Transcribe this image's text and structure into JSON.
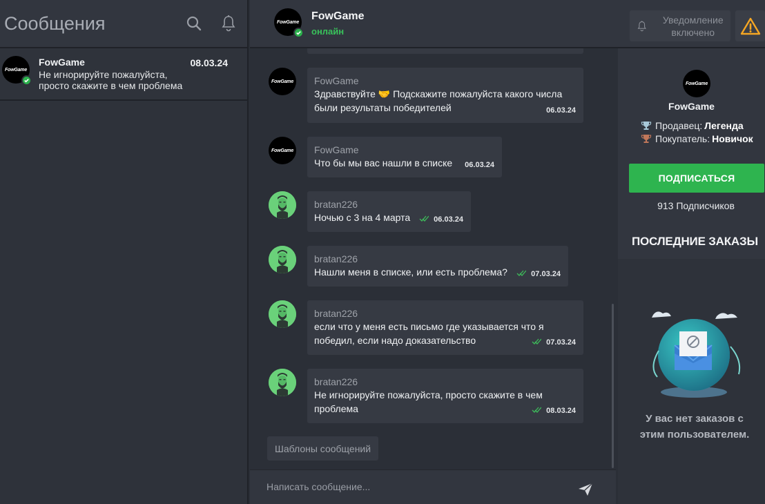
{
  "sidebar": {
    "title": "Сообщения",
    "conversations": [
      {
        "name": "FowGame",
        "date": "08.03.24",
        "preview": "Не игнорируйте пожалуйста, просто скажите в чем проблема",
        "avatar_text": "FowGame"
      }
    ]
  },
  "chat": {
    "name": "FowGame",
    "status": "онлайн",
    "avatar_text": "FowGame",
    "notification_label": "Уведомление включено",
    "messages": [
      {
        "author": "FowGame",
        "text": "Здравствуйте 🤝 Подскажите пожалуйста какого числа были результаты победителей",
        "time": "06.03.24",
        "read": false
      },
      {
        "author": "FowGame",
        "text": "Что бы мы вас нашли в списке",
        "time": "06.03.24",
        "read": false
      },
      {
        "author": "bratan226",
        "text": "Ночью с 3 на 4 марта",
        "time": "06.03.24",
        "read": true
      },
      {
        "author": "bratan226",
        "text": "Нашли меня в списке, или есть проблема?",
        "time": "07.03.24",
        "read": true
      },
      {
        "author": "bratan226",
        "text": "если что у меня есть письмо где указывается что я победил, если надо доказательство",
        "time": "07.03.24",
        "read": true
      },
      {
        "author": "bratan226",
        "text": "Не игнорируйте пожалуйста, просто скажите в чем проблема",
        "time": "08.03.24",
        "read": true
      }
    ],
    "templates_label": "Шаблоны сообщений",
    "composer_placeholder": "Написать сообщение..."
  },
  "profile": {
    "name": "FowGame",
    "avatar_text": "FowGame",
    "seller_label": "Продавец:",
    "seller_rank": "Легенда",
    "buyer_label": "Покупатель:",
    "buyer_rank": "Новичок",
    "subscribe_label": "ПОДПИСАТЬСЯ",
    "subscribers": "913 Подписчиков",
    "orders_title": "ПОСЛЕДНИЕ ЗАКАЗЫ",
    "empty_orders": "У вас нет заказов с этим пользователем."
  },
  "colors": {
    "accent_green": "#2eb44f",
    "online_green": "#39c25b",
    "warning_orange": "#f5a623",
    "background": "#2b2f37"
  }
}
